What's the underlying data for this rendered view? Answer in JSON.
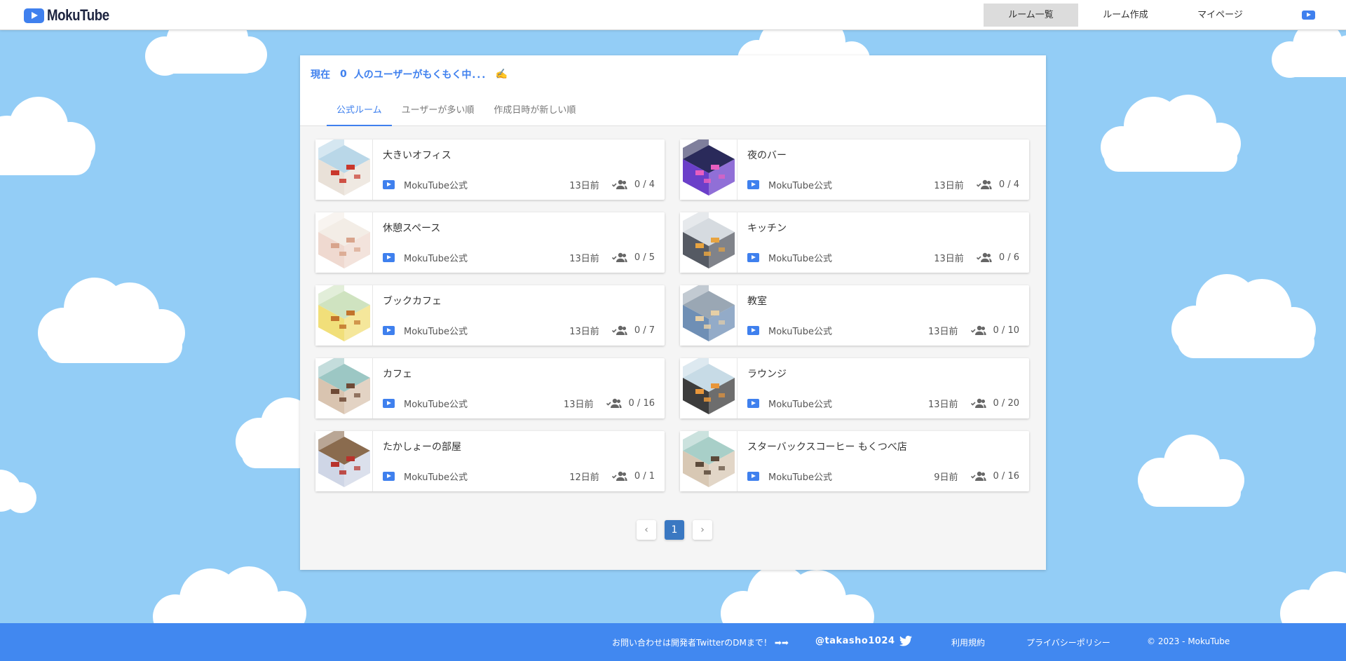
{
  "header": {
    "logo_text": "MokuTube",
    "nav": [
      {
        "label": "ルーム一覧",
        "active": true
      },
      {
        "label": "ルーム作成",
        "active": false
      },
      {
        "label": "マイページ",
        "active": false
      }
    ]
  },
  "status": {
    "prefix": "現在",
    "count": "0",
    "suffix": "人のユーザーがもくもく中．．．",
    "emoji": "✍️"
  },
  "tabs": [
    {
      "label": "公式ルーム",
      "active": true
    },
    {
      "label": "ユーザーが多い順",
      "active": false
    },
    {
      "label": "作成日時が新しい順",
      "active": false
    }
  ],
  "rooms": [
    {
      "name": "大きいオフィス",
      "owner": "MokuTube公式",
      "created": "13日前",
      "capacity": "0 / 4"
    },
    {
      "name": "夜のバー",
      "owner": "MokuTube公式",
      "created": "13日前",
      "capacity": "0 / 4"
    },
    {
      "name": "休憩スペース",
      "owner": "MokuTube公式",
      "created": "13日前",
      "capacity": "0 / 5"
    },
    {
      "name": "キッチン",
      "owner": "MokuTube公式",
      "created": "13日前",
      "capacity": "0 / 6"
    },
    {
      "name": "ブックカフェ",
      "owner": "MokuTube公式",
      "created": "13日前",
      "capacity": "0 / 7"
    },
    {
      "name": "教室",
      "owner": "MokuTube公式",
      "created": "13日前",
      "capacity": "0 / 10"
    },
    {
      "name": "カフェ",
      "owner": "MokuTube公式",
      "created": "13日前",
      "capacity": "0 / 16"
    },
    {
      "name": "ラウンジ",
      "owner": "MokuTube公式",
      "created": "13日前",
      "capacity": "0 / 20"
    },
    {
      "name": "たかしょーの部屋",
      "owner": "MokuTube公式",
      "created": "12日前",
      "capacity": "0 / 1"
    },
    {
      "name": "スターバックスコーヒー もくつべ店",
      "owner": "MokuTube公式",
      "created": "9日前",
      "capacity": "0 / 16"
    }
  ],
  "pagination": {
    "prev": "‹",
    "current": "1",
    "next": "›"
  },
  "footer": {
    "contact": "お問い合わせは開発者TwitterのDMまで！",
    "arrows": "➡➡",
    "handle": "@takasho1024",
    "terms": "利用規約",
    "privacy": "プライバシーポリシー",
    "copyright": "© 2023 - MokuTube"
  },
  "colors": {
    "sky": "#93cdf6",
    "accent": "#3f80ee",
    "footer": "#4188f0",
    "pager_active": "#3a78c2"
  },
  "thumbnail_palettes": [
    [
      "#e9e1d8",
      "#c9372c",
      "#b9d7e8"
    ],
    [
      "#6b3fc9",
      "#e85fc0",
      "#2a2a5a"
    ],
    [
      "#efd9d0",
      "#d8a48c",
      "#f3ede6"
    ],
    [
      "#555a63",
      "#e8a440",
      "#d6dbe0"
    ],
    [
      "#f1df7a",
      "#c2742c",
      "#cfe3c0"
    ],
    [
      "#6f8fb5",
      "#e6cfa6",
      "#9aa7b4"
    ],
    [
      "#d9c4b0",
      "#6e4a36",
      "#9cc7c4"
    ],
    [
      "#3c3c3c",
      "#e8963a",
      "#c7dbe6"
    ],
    [
      "#cfd6e6",
      "#b8322b",
      "#8a6b4e"
    ],
    [
      "#d8c8b4",
      "#5c4a3a",
      "#a8cfc8"
    ]
  ]
}
